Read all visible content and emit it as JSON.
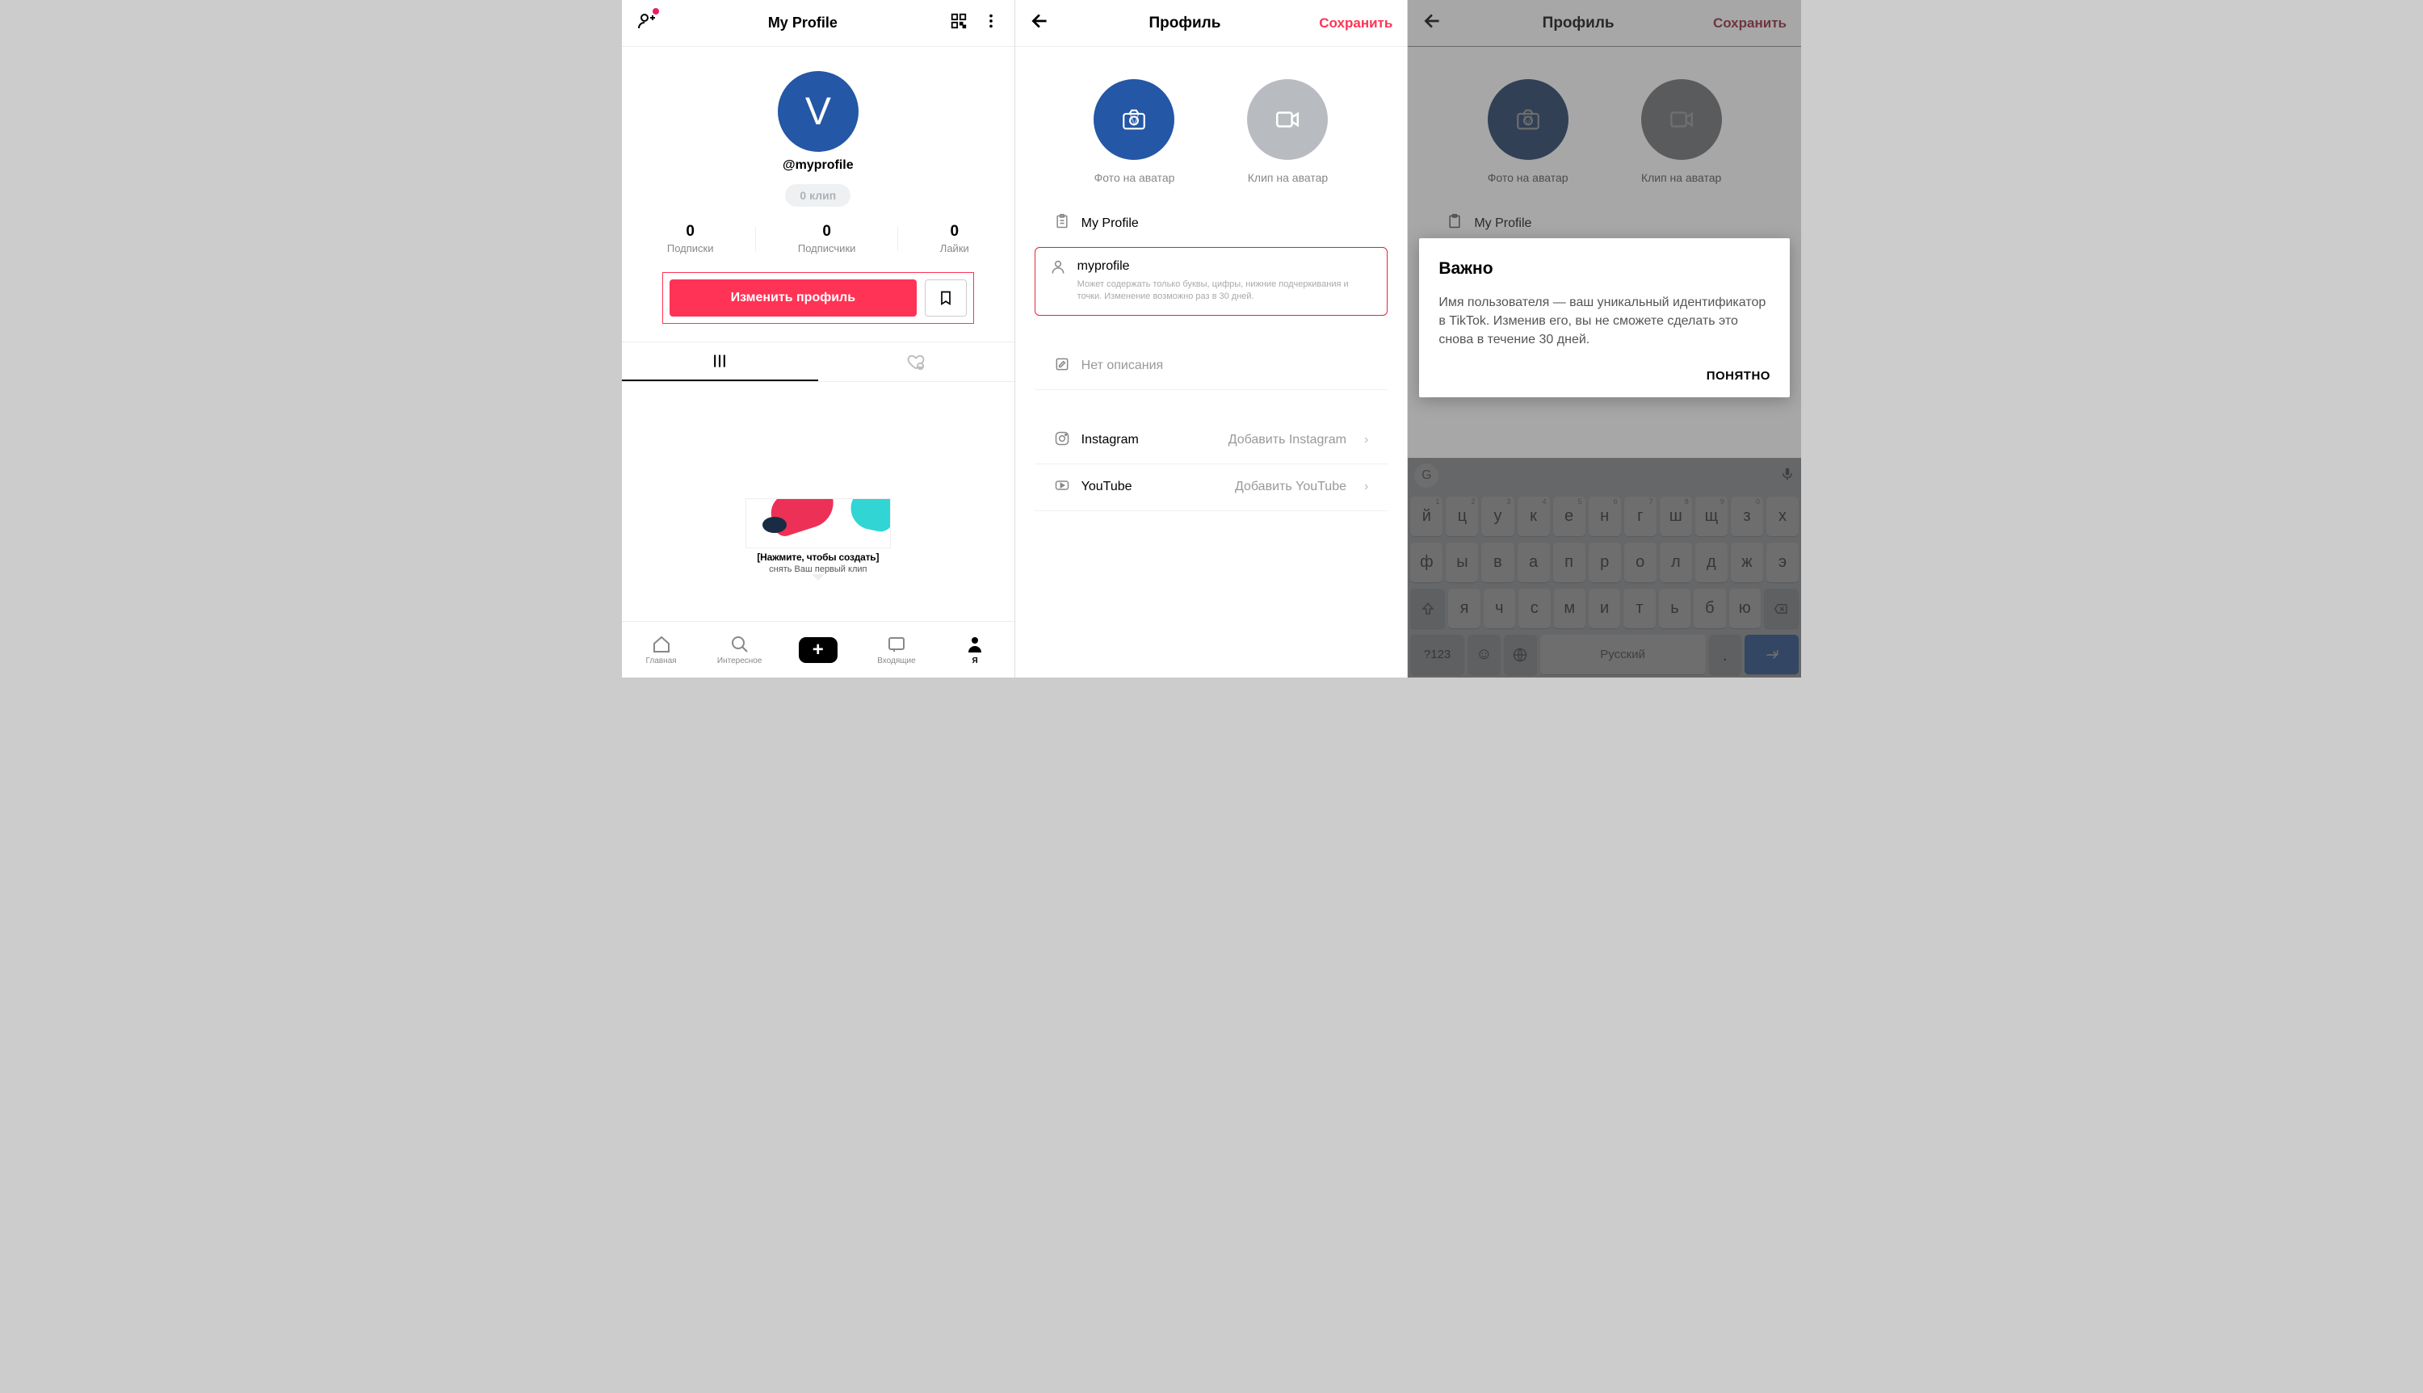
{
  "screen1": {
    "header": {
      "title": "My Profile"
    },
    "avatar_letter": "V",
    "handle": "@myprofile",
    "clip_badge": "0 клип",
    "stats": [
      {
        "value": "0",
        "label": "Подписки"
      },
      {
        "value": "0",
        "label": "Подписчики"
      },
      {
        "value": "0",
        "label": "Лайки"
      }
    ],
    "edit_button": "Изменить профиль",
    "hint": {
      "line1": "[Нажмите, чтобы создать]",
      "line2": "снять Ваш первый клип"
    },
    "nav": {
      "home": "Главная",
      "discover": "Интересное",
      "inbox": "Входящие",
      "me": "Я"
    }
  },
  "screen2": {
    "header": {
      "title": "Профиль",
      "save": "Сохранить"
    },
    "avatar_photo_label": "Фото на аватар",
    "avatar_clip_label": "Клип на аватар",
    "fields": {
      "display_name": "My Profile",
      "username": "myprofile",
      "username_hint": "Может содержать только буквы, цифры, нижние подчеркивания и точки. Изменение возможно раз в 30 дней.",
      "bio_placeholder": "Нет описания",
      "instagram_label": "Instagram",
      "instagram_action": "Добавить Instagram",
      "youtube_label": "YouTube",
      "youtube_action": "Добавить YouTube"
    }
  },
  "screen3": {
    "dialog": {
      "title": "Важно",
      "body": "Имя пользователя — ваш уникальный идентификатор в TikTok. Изменив его, вы не сможете сделать это снова в течение 30 дней.",
      "ok": "ПОНЯТНО"
    },
    "keyboard": {
      "row1": [
        "й",
        "ц",
        "у",
        "к",
        "е",
        "н",
        "г",
        "ш",
        "щ",
        "з",
        "х"
      ],
      "row1_idx": [
        "1",
        "2",
        "3",
        "4",
        "5",
        "6",
        "7",
        "8",
        "9",
        "0",
        ""
      ],
      "row2": [
        "ф",
        "ы",
        "в",
        "а",
        "п",
        "р",
        "о",
        "л",
        "д",
        "ж",
        "э"
      ],
      "row3": [
        "я",
        "ч",
        "с",
        "м",
        "и",
        "т",
        "ь",
        "б",
        "ю"
      ],
      "space": "Русский",
      "numeric": "?123"
    }
  }
}
